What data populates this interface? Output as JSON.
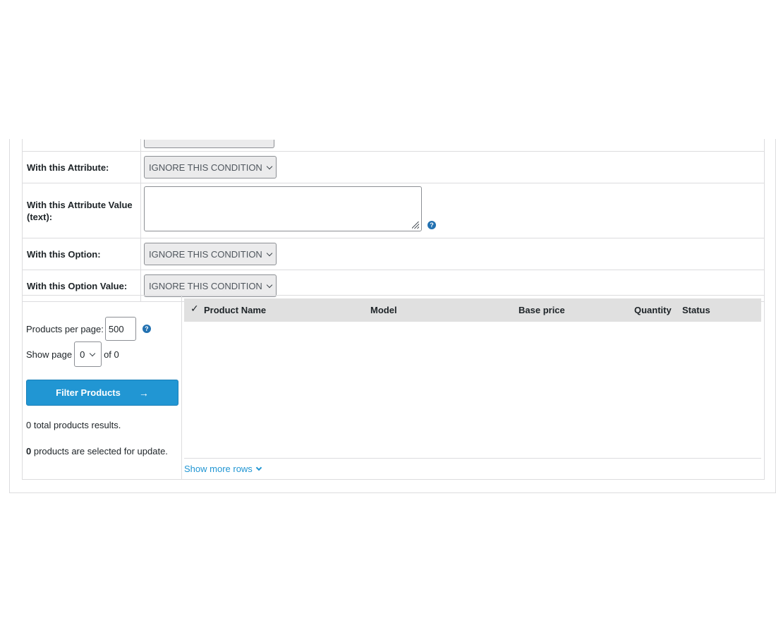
{
  "conditions": {
    "rows": [
      {
        "label": "",
        "value": ""
      },
      {
        "label": "With this Attribute:",
        "value": "IGNORE THIS CONDITION"
      },
      {
        "label": "With this Attribute Value (text):",
        "value": ""
      },
      {
        "label": "With this Option:",
        "value": "IGNORE THIS CONDITION"
      },
      {
        "label": "With this Option Value:",
        "value": "IGNORE THIS CONDITION"
      }
    ],
    "help_glyph": "?"
  },
  "pagination": {
    "per_page_label": "Products per page:",
    "per_page_value": "500",
    "show_page_label": "Show page",
    "page_value": "0",
    "of_label": "of 0"
  },
  "actions": {
    "filter_label": "Filter Products",
    "filter_arrow": "→"
  },
  "results": {
    "total_text": "0 total products results.",
    "selected_count": "0",
    "selected_text": " products are selected for update."
  },
  "grid": {
    "check_glyph": "✓",
    "columns": [
      "Product Name",
      "Model",
      "Base price",
      "Quantity",
      "Status"
    ],
    "show_more_label": "Show more rows"
  },
  "colors": {
    "accent": "#2196d3",
    "header_bg": "#e0e0e0",
    "select_bg": "#ebebec",
    "border": "#dcdcde"
  }
}
